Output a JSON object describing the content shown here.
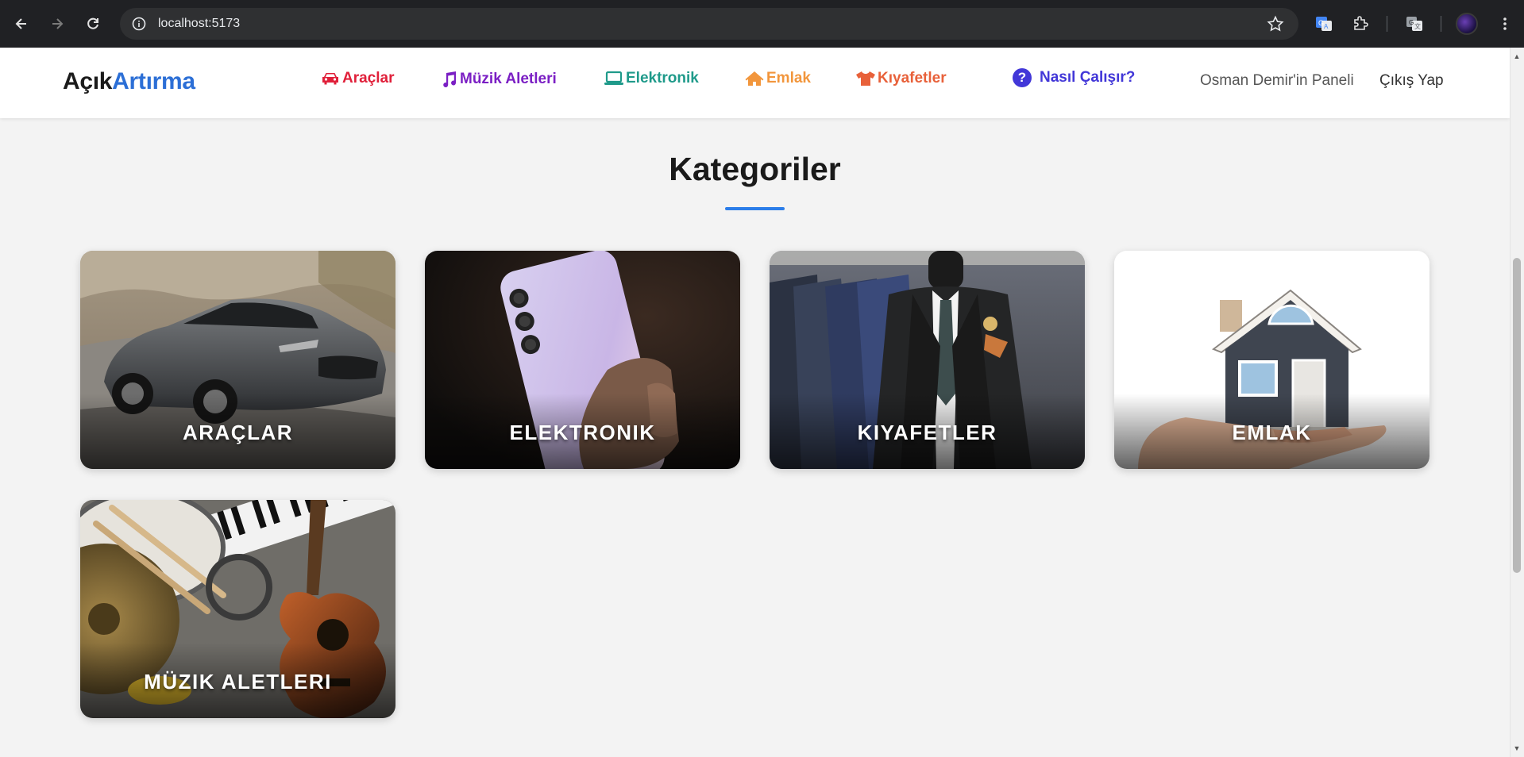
{
  "browser": {
    "url": "localhost:5173",
    "icons": {
      "back": "arrow-left-icon",
      "forward": "arrow-right-icon",
      "reload": "reload-icon",
      "site_info": "info-icon",
      "bookmark": "star-icon",
      "translate_ext": "translate-icon",
      "extensions": "puzzle-icon",
      "translate_page": "translate-page-icon",
      "menu": "kebab-menu-icon"
    }
  },
  "header": {
    "logo_part1": "Açık",
    "logo_part2": "Artırma",
    "nav": [
      {
        "label": "Araçlar",
        "icon": "car-icon",
        "color": "#e0203a"
      },
      {
        "label": "Müzik Aletleri",
        "icon": "music-note-icon",
        "color": "#7b1fc4"
      },
      {
        "label": "Elektronik",
        "icon": "laptop-icon",
        "color": "#1f9a8a"
      },
      {
        "label": "Emlak",
        "icon": "house-icon",
        "color": "#f2963c"
      },
      {
        "label": "Kıyafetler",
        "icon": "tshirt-icon",
        "color": "#e8613a"
      }
    ],
    "how_it_works": "Nasıl Çalışır?",
    "how_it_works_icon": "question-circle-icon",
    "user_panel": "Osman Demir'in Paneli",
    "logout": "Çıkış Yap"
  },
  "main": {
    "title": "Kategoriler",
    "categories": [
      {
        "label": "ARAÇLAR",
        "image": "car-photo"
      },
      {
        "label": "ELEKTRONIK",
        "image": "smartphone-photo"
      },
      {
        "label": "KIYAFETLER",
        "image": "suit-photo"
      },
      {
        "label": "EMLAK",
        "image": "house-in-hand-photo"
      },
      {
        "label": "MÜZIK ALETLERI",
        "image": "instruments-photo"
      }
    ]
  },
  "colors": {
    "brand_blue": "#2c6fd6",
    "accent_underline": "#2b7de9",
    "howto_purple": "#4237d8",
    "page_bg": "#f3f3f3"
  }
}
